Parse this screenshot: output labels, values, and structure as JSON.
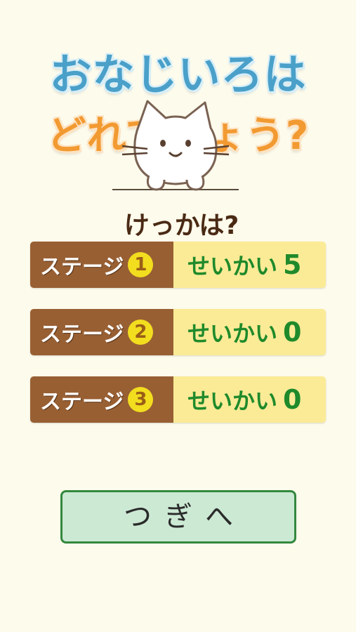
{
  "title": {
    "line1": "おなじいろは",
    "line2": "どれでしょう?"
  },
  "result_label": "けっかは?",
  "stages": [
    {
      "label": "ステージ",
      "number": "1",
      "correct_label": "せいかい",
      "correct_count": "5"
    },
    {
      "label": "ステージ",
      "number": "2",
      "correct_label": "せいかい",
      "correct_count": "0"
    },
    {
      "label": "ステージ",
      "number": "3",
      "correct_label": "せいかい",
      "correct_count": "0"
    }
  ],
  "next_button": "つぎへ",
  "colors": {
    "background": "#fdfbec",
    "stage_left": "#985f33",
    "stage_right": "#fbeb96",
    "correct_text": "#1f8a2b",
    "button_bg": "#cce9d4",
    "button_border": "#33883d"
  },
  "icons": [
    "cat-mascot"
  ]
}
